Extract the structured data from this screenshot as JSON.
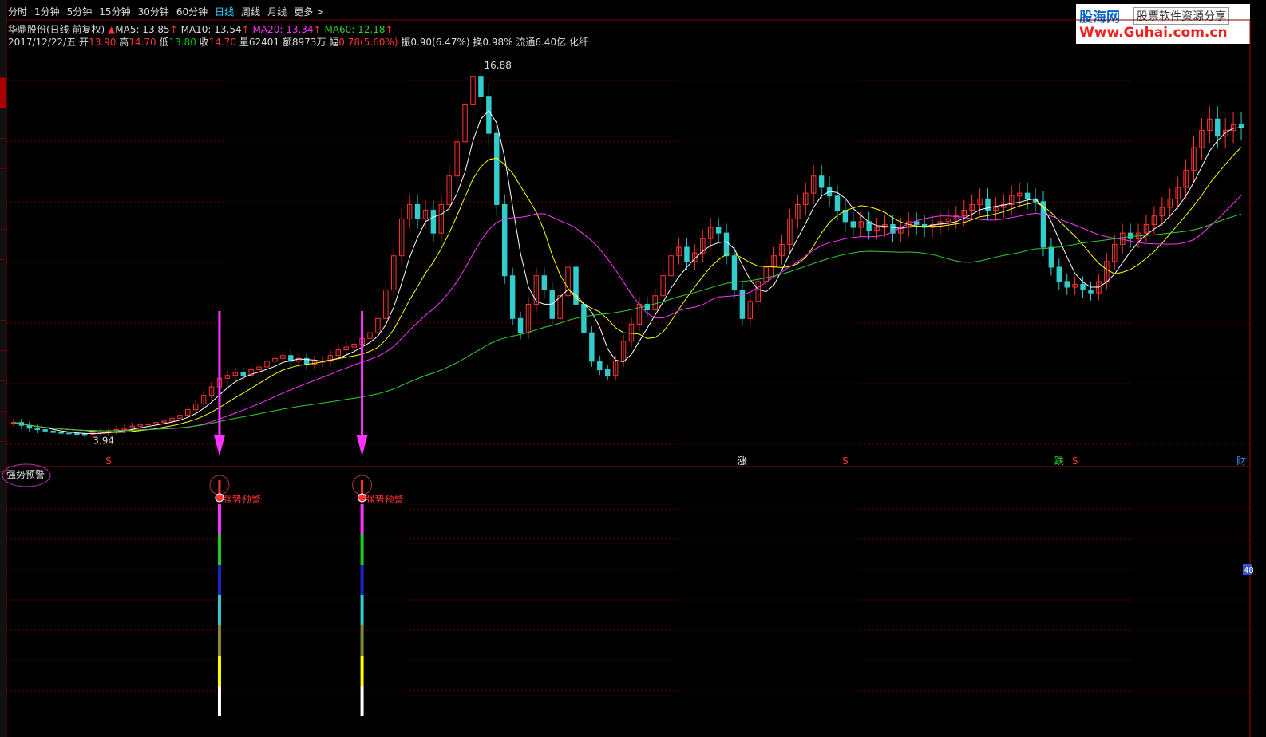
{
  "toolbar": {
    "items": [
      "分时",
      "1分钟",
      "5分钟",
      "15分钟",
      "30分钟",
      "60分钟",
      "日线",
      "周线",
      "月线",
      "更多 >"
    ],
    "active_index": 6
  },
  "info": {
    "stock_name": "华鼎股份(日线 前复权)",
    "ma5": "MA5: 13.85",
    "ma10": "MA10: 13.54",
    "ma20": "MA20: 13.34",
    "ma60": "MA60: 12.18",
    "date": "2017/12/22/五",
    "open_label": "开",
    "open": "13.90",
    "high_label": "高",
    "high": "14.70",
    "low_label": "低",
    "low": "13.80",
    "close_label": "收",
    "close": "14.70",
    "vol_label": "量",
    "vol": "62401",
    "amount_label": "额",
    "amount": "8973万",
    "change_label": "幅",
    "change": "0.78(5.60%)",
    "amp_label": "振",
    "amp": "0.90(6.47%)",
    "turnover_label": "换",
    "turnover": "0.98%",
    "float_label": "流通",
    "float": "6.40亿",
    "industry": "化纤"
  },
  "logo": {
    "line1a": "股海网",
    "line1b": "股票软件资源分享",
    "line2": "Www.Guhai.com.cn"
  },
  "indicator": {
    "name": "强势预警",
    "signal_label": "强势预警",
    "right_value": "48"
  },
  "colors": {
    "ma5": "#ffffff",
    "ma10": "#ffff00",
    "ma20": "#ff33ff",
    "ma60": "#33cc33",
    "up": "#ff3333",
    "down": "#33cccc",
    "grid": "#600000",
    "arrow": "#ff33ff"
  },
  "chart_data": {
    "type": "candlestick",
    "price_range": [
      3.5,
      17.5
    ],
    "annotations": {
      "max_label": "16.88",
      "min_label": "3.94"
    },
    "markers": [
      {
        "label": "S",
        "color": "#ff3333",
        "index": 12
      },
      {
        "label": "涨",
        "color": "#ffffff",
        "index": 92
      },
      {
        "label": "S",
        "color": "#ff3333",
        "index": 105
      },
      {
        "label": "跌",
        "color": "#33cc33",
        "index": 132
      },
      {
        "label": "S",
        "color": "#ff3333",
        "index": 134
      },
      {
        "label": "财",
        "color": "#3399ff",
        "index": 155
      }
    ],
    "signals": [
      {
        "index": 26
      },
      {
        "index": 44
      },
      {
        "index": 161
      }
    ],
    "close": [
      4.35,
      4.25,
      4.15,
      4.1,
      4.05,
      4.0,
      3.98,
      3.96,
      3.95,
      3.94,
      3.98,
      4.02,
      4.05,
      4.1,
      4.15,
      4.22,
      4.28,
      4.3,
      4.35,
      4.4,
      4.5,
      4.6,
      4.8,
      5.0,
      5.3,
      5.6,
      5.9,
      6.0,
      6.1,
      6.0,
      6.2,
      6.3,
      6.5,
      6.6,
      6.7,
      6.5,
      6.6,
      6.4,
      6.5,
      6.5,
      6.7,
      6.9,
      7.0,
      7.1,
      7.3,
      7.5,
      8.0,
      9.0,
      10.2,
      11.5,
      12.0,
      11.5,
      11.8,
      11.0,
      12.0,
      13.0,
      14.2,
      15.5,
      16.5,
      15.8,
      14.5,
      12.0,
      9.5,
      8.0,
      7.5,
      8.5,
      9.5,
      9.0,
      8.0,
      8.8,
      9.8,
      8.5,
      7.5,
      6.5,
      6.2,
      6.0,
      6.5,
      7.2,
      7.8,
      8.5,
      8.3,
      8.8,
      9.5,
      10.2,
      10.5,
      10.0,
      10.3,
      10.8,
      11.2,
      11.0,
      10.2,
      9.0,
      8.0,
      8.6,
      9.3,
      9.8,
      10.2,
      10.6,
      11.5,
      12.0,
      12.4,
      13.0,
      12.6,
      12.3,
      11.8,
      11.4,
      11.2,
      11.4,
      11.1,
      11.2,
      11.3,
      11.0,
      11.2,
      11.4,
      11.3,
      11.2,
      11.3,
      11.4,
      11.5,
      11.6,
      11.8,
      12.0,
      12.2,
      11.8,
      11.9,
      12.0,
      12.3,
      12.4,
      12.2,
      12.1,
      10.5,
      9.8,
      9.3,
      9.1,
      9.2,
      9.0,
      8.9,
      9.3,
      10.0,
      10.6,
      11.0,
      10.8,
      11.0,
      11.3,
      11.6,
      11.9,
      12.2,
      12.6,
      13.2,
      14.0,
      14.6,
      15.0,
      14.4,
      14.6,
      14.8,
      14.7
    ]
  }
}
